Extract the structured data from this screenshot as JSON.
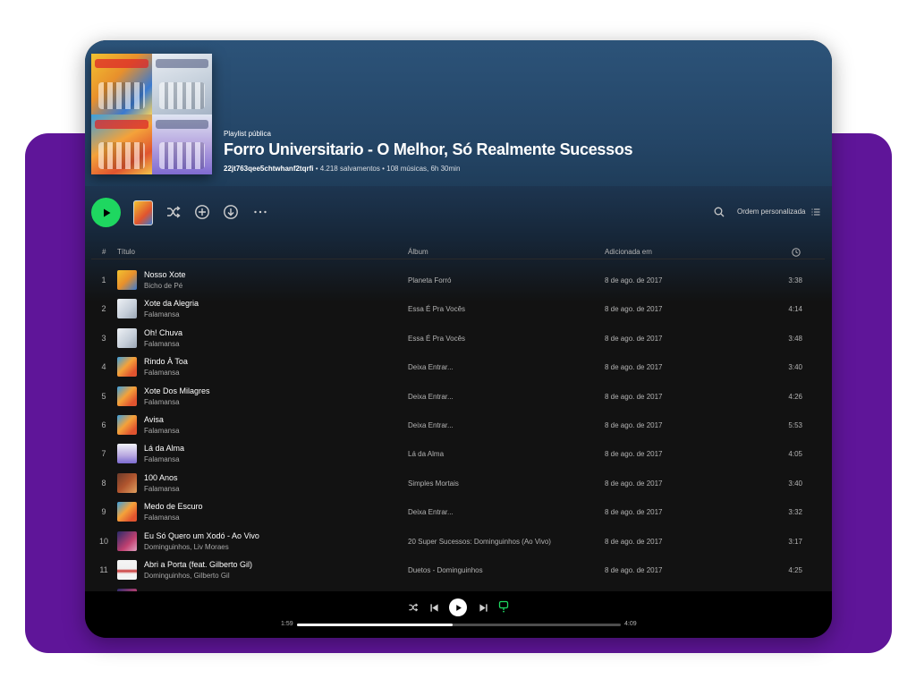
{
  "colors": {
    "purple": "#5f1599",
    "accent": "#1ed760",
    "header": "#2c5379",
    "window": "#121212"
  },
  "playlist": {
    "type_label": "Playlist pública",
    "title": "Forro Universitario - O Melhor, Só Realmente Sucessos",
    "owner": "22jt763qee5chtwhanf2tqrfi",
    "stats": " • 4.218 salvamentos • 108 músicas, 6h 30min"
  },
  "toolbar": {
    "icons": [
      "play-icon",
      "shuffle-icon",
      "add-circle-icon",
      "download-icon",
      "more-icon",
      "search-icon",
      "list-icon"
    ],
    "sort_label": "Ordem personalizada"
  },
  "columns": {
    "number": "#",
    "title": "Título",
    "album": "Álbum",
    "added": "Adicionada em"
  },
  "tracks": [
    {
      "num": "1",
      "title": "Nosso Xote",
      "artist": "Bicho de Pé",
      "album": "Planeta Forró",
      "added": "8 de ago. de 2017",
      "duration": "3:38",
      "art": "a-bicho"
    },
    {
      "num": "2",
      "title": "Xote da Alegria",
      "artist": "Falamansa",
      "album": "Essa É Pra Vocês",
      "added": "8 de ago. de 2017",
      "duration": "4:14",
      "art": "a-essa"
    },
    {
      "num": "3",
      "title": "Oh! Chuva",
      "artist": "Falamansa",
      "album": "Essa É Pra Vocês",
      "added": "8 de ago. de 2017",
      "duration": "3:48",
      "art": "a-essa"
    },
    {
      "num": "4",
      "title": "Rindo À Toa",
      "artist": "Falamansa",
      "album": "Deixa Entrar...",
      "added": "8 de ago. de 2017",
      "duration": "3:40",
      "art": "a-deixa"
    },
    {
      "num": "5",
      "title": "Xote Dos Milagres",
      "artist": "Falamansa",
      "album": "Deixa Entrar...",
      "added": "8 de ago. de 2017",
      "duration": "4:26",
      "art": "a-deixa"
    },
    {
      "num": "6",
      "title": "Avisa",
      "artist": "Falamansa",
      "album": "Deixa Entrar...",
      "added": "8 de ago. de 2017",
      "duration": "5:53",
      "art": "a-deixa"
    },
    {
      "num": "7",
      "title": "Lá da Alma",
      "artist": "Falamansa",
      "album": "Lá da Alma",
      "added": "8 de ago. de 2017",
      "duration": "4:05",
      "art": "a-alma"
    },
    {
      "num": "8",
      "title": "100 Anos",
      "artist": "Falamansa",
      "album": "Simples Mortais",
      "added": "8 de ago. de 2017",
      "duration": "3:40",
      "art": "a-simples"
    },
    {
      "num": "9",
      "title": "Medo de Escuro",
      "artist": "Falamansa",
      "album": "Deixa Entrar...",
      "added": "8 de ago. de 2017",
      "duration": "3:32",
      "art": "a-deixa"
    },
    {
      "num": "10",
      "title": "Eu Só Quero um Xodó - Ao Vivo",
      "artist": "Dominguinhos, Liv Moraes",
      "album": "20 Super Sucessos: Dominguinhos (Ao Vivo)",
      "added": "8 de ago. de 2017",
      "duration": "3:17",
      "art": "a-domi"
    },
    {
      "num": "11",
      "title": "Abri a Porta (feat. Gilberto Gil)",
      "artist": "Dominguinhos, Gilberto Gil",
      "album": "Duetos - Dominguinhos",
      "added": "8 de ago. de 2017",
      "duration": "4:25",
      "art": "a-duetos"
    }
  ],
  "player": {
    "current_time": "1:59",
    "total_time": "4:09",
    "progress": 0.48,
    "icons": [
      "shuffle-icon",
      "previous-icon",
      "play-icon",
      "next-icon",
      "lyrics-icon"
    ]
  }
}
